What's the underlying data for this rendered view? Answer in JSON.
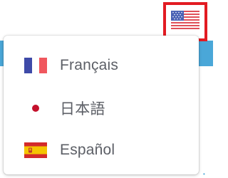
{
  "header": {
    "current_language_flag_icon": "us-flag-icon",
    "accent_blue": "#4aa7d8",
    "highlight_red": "#e21b22"
  },
  "language_menu": {
    "items": [
      {
        "label": "Français",
        "flag_icon": "france-flag-icon"
      },
      {
        "label": "日本語",
        "flag_icon": "japan-flag-icon"
      },
      {
        "label": "Español",
        "flag_icon": "spain-flag-icon"
      }
    ]
  }
}
